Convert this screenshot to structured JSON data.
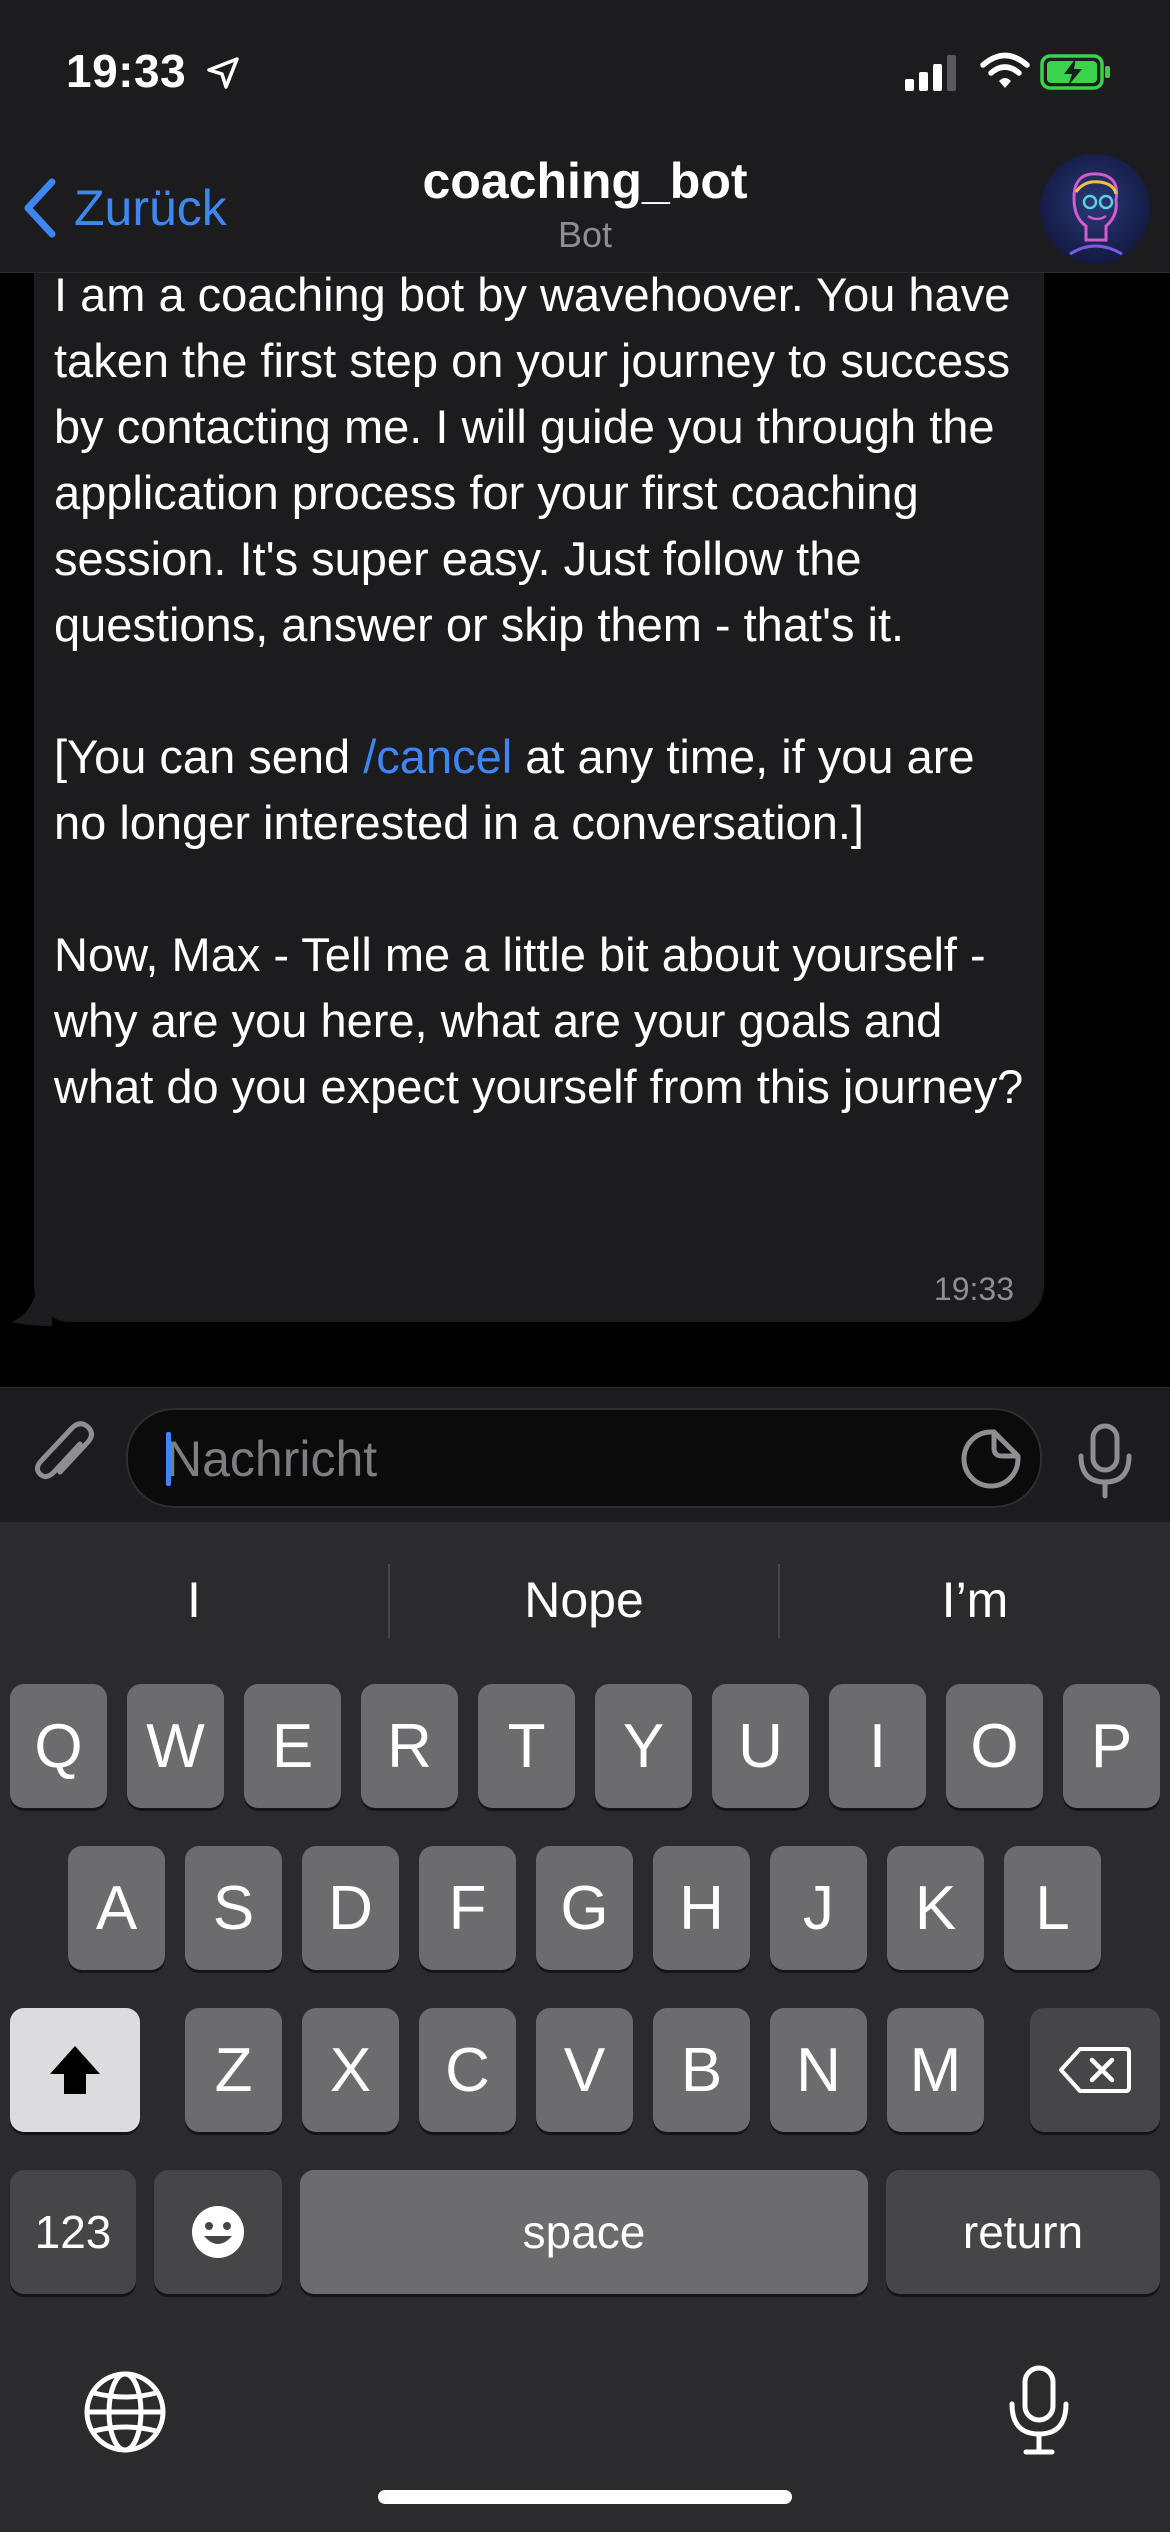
{
  "status": {
    "time": "19:33"
  },
  "header": {
    "back_label": "Zurück",
    "title": "coaching_bot",
    "subtitle": "Bot"
  },
  "message": {
    "paragraph1": "I am a coaching bot by wavehoover. You have taken the first step on your journey to success by contacting me. I will guide you through the application process for your first coaching session. It's super easy. Just follow the questions, answer or skip them - that's it.",
    "paragraph2_pre": "[You can send ",
    "paragraph2_link": "/cancel",
    "paragraph2_post": " at any time, if you are no longer interested in a conversation.]",
    "paragraph3": "Now, Max - Tell me a little bit about yourself - why are you here, what are your goals and what do you expect yourself from this journey?",
    "time": "19:33"
  },
  "input": {
    "placeholder": "Nachricht",
    "value": ""
  },
  "keyboard": {
    "suggestions": [
      "I",
      "Nope",
      "I’m"
    ],
    "row1": [
      "Q",
      "W",
      "E",
      "R",
      "T",
      "Y",
      "U",
      "I",
      "O",
      "P"
    ],
    "row2": [
      "A",
      "S",
      "D",
      "F",
      "G",
      "H",
      "J",
      "K",
      "L"
    ],
    "row3": [
      "Z",
      "X",
      "C",
      "V",
      "B",
      "N",
      "M"
    ],
    "numbers_label": "123",
    "space_label": "space",
    "return_label": "return"
  },
  "colors": {
    "accent": "#3e87f3",
    "bubble": "#1c1c1e",
    "keyboard": "#2b2b2d"
  }
}
